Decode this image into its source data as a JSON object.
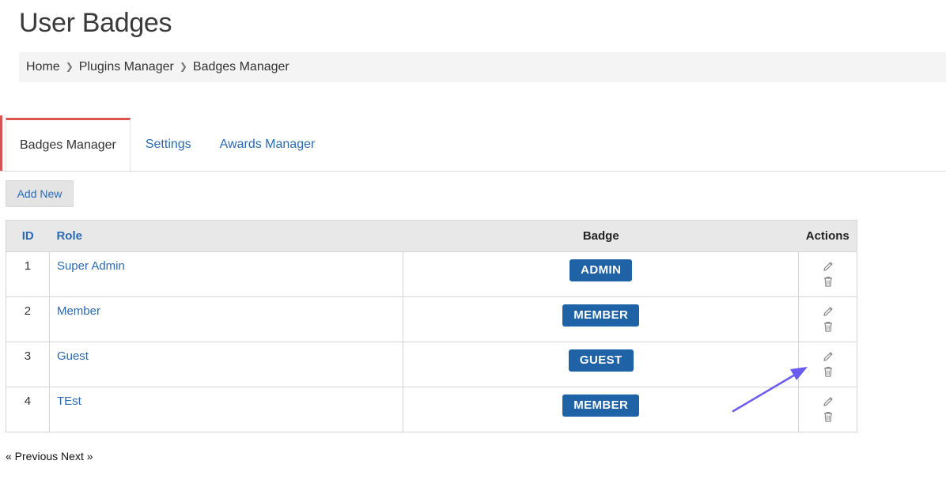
{
  "page": {
    "title": "User Badges"
  },
  "breadcrumb": [
    "Home",
    "Plugins Manager",
    "Badges Manager"
  ],
  "tabs": [
    {
      "label": "Badges Manager",
      "active": true
    },
    {
      "label": "Settings",
      "active": false
    },
    {
      "label": "Awards Manager",
      "active": false
    }
  ],
  "toolbar": {
    "add_label": "Add New"
  },
  "table": {
    "headers": {
      "id": "ID",
      "role": "Role",
      "badge": "Badge",
      "actions": "Actions"
    },
    "rows": [
      {
        "id": "1",
        "role": "Super Admin",
        "badge": "ADMIN"
      },
      {
        "id": "2",
        "role": "Member",
        "badge": "MEMBER"
      },
      {
        "id": "3",
        "role": "Guest",
        "badge": "GUEST"
      },
      {
        "id": "4",
        "role": "TEst",
        "badge": "MEMBER"
      }
    ],
    "action_icons": [
      "pencil-icon",
      "trash-icon"
    ]
  },
  "pagination": {
    "previous": "« Previous",
    "next": "Next »"
  },
  "colors": {
    "accent": "#d9534f",
    "link": "#2a6ab2",
    "badge": "#1f63a6",
    "annotation_arrow": "#6a5cf0"
  }
}
